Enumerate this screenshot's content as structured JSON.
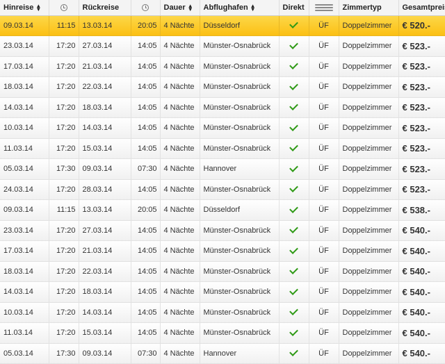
{
  "header": {
    "departure": "Hinreise",
    "return": "Rückreise",
    "duration": "Dauer",
    "airport": "Abflughafen",
    "direct": "Direkt",
    "room_type": "Zimmertyp",
    "total_price": "Gesamtpreis",
    "sort_icon": "sort-up-down-icon",
    "time_icon": "clock-icon",
    "meal_icon": "cutlery-icon"
  },
  "colors": {
    "highlight": "#fbbf12",
    "check": "#2f9a16"
  },
  "rows": [
    {
      "dep_date": "09.03.14",
      "dep_time": "11:15",
      "ret_date": "13.03.14",
      "ret_time": "20:05",
      "duration": "4 Nächte",
      "airport": "Düsseldorf",
      "direct": true,
      "meal": "ÜF",
      "room": "Doppelzimmer",
      "price": "€ 520.-",
      "highlight": true
    },
    {
      "dep_date": "23.03.14",
      "dep_time": "17:20",
      "ret_date": "27.03.14",
      "ret_time": "14:05",
      "duration": "4 Nächte",
      "airport": "Münster-Osnabrück",
      "direct": true,
      "meal": "ÜF",
      "room": "Doppelzimmer",
      "price": "€ 523.-"
    },
    {
      "dep_date": "17.03.14",
      "dep_time": "17:20",
      "ret_date": "21.03.14",
      "ret_time": "14:05",
      "duration": "4 Nächte",
      "airport": "Münster-Osnabrück",
      "direct": true,
      "meal": "ÜF",
      "room": "Doppelzimmer",
      "price": "€ 523.-"
    },
    {
      "dep_date": "18.03.14",
      "dep_time": "17:20",
      "ret_date": "22.03.14",
      "ret_time": "14:05",
      "duration": "4 Nächte",
      "airport": "Münster-Osnabrück",
      "direct": true,
      "meal": "ÜF",
      "room": "Doppelzimmer",
      "price": "€ 523.-"
    },
    {
      "dep_date": "14.03.14",
      "dep_time": "17:20",
      "ret_date": "18.03.14",
      "ret_time": "14:05",
      "duration": "4 Nächte",
      "airport": "Münster-Osnabrück",
      "direct": true,
      "meal": "ÜF",
      "room": "Doppelzimmer",
      "price": "€ 523.-"
    },
    {
      "dep_date": "10.03.14",
      "dep_time": "17:20",
      "ret_date": "14.03.14",
      "ret_time": "14:05",
      "duration": "4 Nächte",
      "airport": "Münster-Osnabrück",
      "direct": true,
      "meal": "ÜF",
      "room": "Doppelzimmer",
      "price": "€ 523.-"
    },
    {
      "dep_date": "11.03.14",
      "dep_time": "17:20",
      "ret_date": "15.03.14",
      "ret_time": "14:05",
      "duration": "4 Nächte",
      "airport": "Münster-Osnabrück",
      "direct": true,
      "meal": "ÜF",
      "room": "Doppelzimmer",
      "price": "€ 523.-"
    },
    {
      "dep_date": "05.03.14",
      "dep_time": "17:30",
      "ret_date": "09.03.14",
      "ret_time": "07:30",
      "duration": "4 Nächte",
      "airport": "Hannover",
      "direct": true,
      "meal": "ÜF",
      "room": "Doppelzimmer",
      "price": "€ 523.-"
    },
    {
      "dep_date": "24.03.14",
      "dep_time": "17:20",
      "ret_date": "28.03.14",
      "ret_time": "14:05",
      "duration": "4 Nächte",
      "airport": "Münster-Osnabrück",
      "direct": true,
      "meal": "ÜF",
      "room": "Doppelzimmer",
      "price": "€ 523.-"
    },
    {
      "dep_date": "09.03.14",
      "dep_time": "11:15",
      "ret_date": "13.03.14",
      "ret_time": "20:05",
      "duration": "4 Nächte",
      "airport": "Düsseldorf",
      "direct": true,
      "meal": "ÜF",
      "room": "Doppelzimmer",
      "price": "€ 538.-"
    },
    {
      "dep_date": "23.03.14",
      "dep_time": "17:20",
      "ret_date": "27.03.14",
      "ret_time": "14:05",
      "duration": "4 Nächte",
      "airport": "Münster-Osnabrück",
      "direct": true,
      "meal": "ÜF",
      "room": "Doppelzimmer",
      "price": "€ 540.-"
    },
    {
      "dep_date": "17.03.14",
      "dep_time": "17:20",
      "ret_date": "21.03.14",
      "ret_time": "14:05",
      "duration": "4 Nächte",
      "airport": "Münster-Osnabrück",
      "direct": true,
      "meal": "ÜF",
      "room": "Doppelzimmer",
      "price": "€ 540.-"
    },
    {
      "dep_date": "18.03.14",
      "dep_time": "17:20",
      "ret_date": "22.03.14",
      "ret_time": "14:05",
      "duration": "4 Nächte",
      "airport": "Münster-Osnabrück",
      "direct": true,
      "meal": "ÜF",
      "room": "Doppelzimmer",
      "price": "€ 540.-"
    },
    {
      "dep_date": "14.03.14",
      "dep_time": "17:20",
      "ret_date": "18.03.14",
      "ret_time": "14:05",
      "duration": "4 Nächte",
      "airport": "Münster-Osnabrück",
      "direct": true,
      "meal": "ÜF",
      "room": "Doppelzimmer",
      "price": "€ 540.-"
    },
    {
      "dep_date": "10.03.14",
      "dep_time": "17:20",
      "ret_date": "14.03.14",
      "ret_time": "14:05",
      "duration": "4 Nächte",
      "airport": "Münster-Osnabrück",
      "direct": true,
      "meal": "ÜF",
      "room": "Doppelzimmer",
      "price": "€ 540.-"
    },
    {
      "dep_date": "11.03.14",
      "dep_time": "17:20",
      "ret_date": "15.03.14",
      "ret_time": "14:05",
      "duration": "4 Nächte",
      "airport": "Münster-Osnabrück",
      "direct": true,
      "meal": "ÜF",
      "room": "Doppelzimmer",
      "price": "€ 540.-"
    },
    {
      "dep_date": "05.03.14",
      "dep_time": "17:30",
      "ret_date": "09.03.14",
      "ret_time": "07:30",
      "duration": "4 Nächte",
      "airport": "Hannover",
      "direct": true,
      "meal": "ÜF",
      "room": "Doppelzimmer",
      "price": "€ 540.-"
    }
  ]
}
